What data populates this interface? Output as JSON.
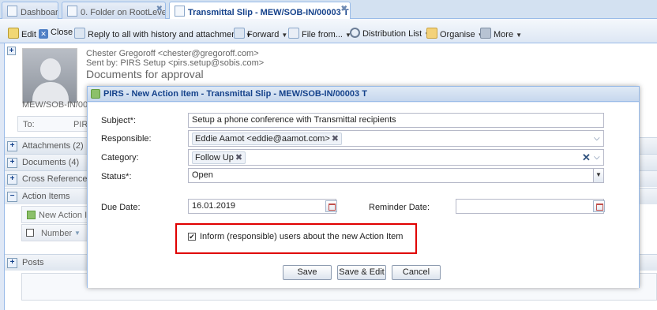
{
  "tabs": [
    {
      "label": "Dashboard"
    },
    {
      "label": "0. Folder on RootLevel"
    },
    {
      "label": "Transmittal Slip - MEW/SOB-IN/00003 T"
    }
  ],
  "toolbar": {
    "edit": "Edit",
    "close": "Close",
    "reply_all": "Reply to all with history and attachments",
    "forward": "Forward",
    "file_from": "File from...",
    "distribution_list": "Distribution List",
    "organise": "Organise",
    "more": "More"
  },
  "message": {
    "from": "Chester Gregoroff <chester@gregoroff.com>",
    "sent_by": "Sent by: PIRS Setup <pirs.setup@sobis.com>",
    "subject": "Documents for approval",
    "ref": "MEW/SOB-IN/000",
    "to_label": "To:",
    "to_value": "PIR"
  },
  "sections": {
    "attachments": "Attachments (2)",
    "documents": "Documents (4)",
    "cross_references": "Cross References",
    "action_items": "Action Items",
    "new_action_item": "New Action Ite",
    "number_col": "Number",
    "posts": "Posts"
  },
  "modal": {
    "title": "PIRS - New Action Item - Transmittal Slip - MEW/SOB-IN/00003 T",
    "subject_label": "Subject*:",
    "subject_value": "Setup a phone conference with Transmittal recipients",
    "responsible_label": "Responsible:",
    "responsible_value": "Eddie Aamot <eddie@aamot.com>",
    "category_label": "Category:",
    "category_value": "Follow Up",
    "status_label": "Status*:",
    "status_value": "Open",
    "due_date_label": "Due Date:",
    "due_date_value": "16.01.2019",
    "reminder_date_label": "Reminder Date:",
    "reminder_date_value": "",
    "inform_checked": true,
    "inform_label": "Inform (responsible) users about the new Action Item",
    "save": "Save",
    "save_edit": "Save & Edit",
    "cancel": "Cancel"
  }
}
